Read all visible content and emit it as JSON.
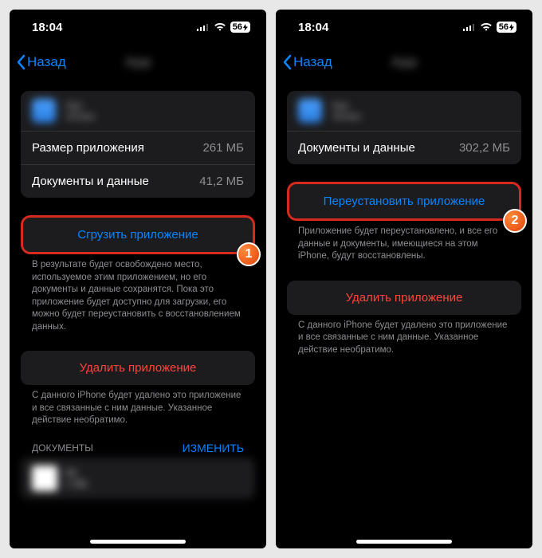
{
  "status": {
    "time": "18:04",
    "battery": "56"
  },
  "nav": {
    "back": "Назад",
    "title": "App"
  },
  "left": {
    "row1_label": "Размер приложения",
    "row1_value": "261 МБ",
    "row2_label": "Документы и данные",
    "row2_value": "41,2 МБ",
    "offload_btn": "Сгрузить приложение",
    "offload_desc": "В результате будет освобождено место, используемое этим приложением, но его документы и данные сохранятся. Пока это приложение будет доступно для загрузки, его можно будет переустановить с восстановлением данных.",
    "delete_btn": "Удалить приложение",
    "delete_desc": "С данного iPhone будет удалено это приложение и все связанные с ним данные. Указанное действие необратимо.",
    "docs_header": "ДОКУМЕНТЫ",
    "edit": "ИЗМЕНИТЬ",
    "badge": "1"
  },
  "right": {
    "row1_label": "Документы и данные",
    "row1_value": "302,2 МБ",
    "reinstall_btn": "Переустановить приложение",
    "reinstall_desc": "Приложение будет переустановлено, и все его данные и документы, имеющиеся на этом iPhone, будут восстановлены.",
    "delete_btn": "Удалить приложение",
    "delete_desc": "С данного iPhone будет удалено это приложение и все связанные с ним данные. Указанное действие необратимо.",
    "badge": "2"
  }
}
